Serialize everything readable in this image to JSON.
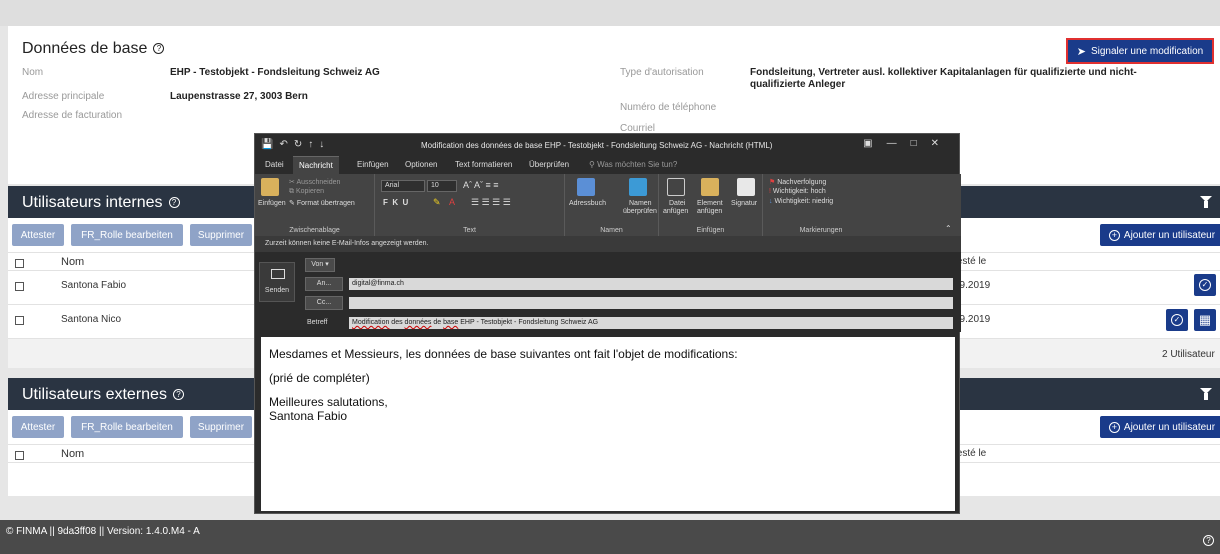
{
  "basic": {
    "title": "Données de base",
    "signal_label": "Signaler une modification",
    "fields": {
      "nom_label": "Nom",
      "nom_value": "EHP - Testobjekt - Fondsleitung Schweiz AG",
      "addr_label": "Adresse principale",
      "addr_value": "Laupenstrasse 27, 3003 Bern",
      "billing_label": "Adresse de facturation",
      "type_label": "Type d'autorisation",
      "type_value": "Fondsleitung, Vertreter ausl. kollektiver Kapitalanlagen für qualifizierte und nicht-qualifizierte Anleger",
      "phone_label": "Numéro de téléphone",
      "email_label": "Courriel"
    }
  },
  "internal": {
    "title": "Utilisateurs internes",
    "buttons": {
      "attester": "Attester",
      "rolle": "FR_Rolle bearbeiten",
      "supprimer": "Supprimer"
    },
    "add_label": "Ajouter un utilisateur",
    "col_name": "Nom",
    "col_tested": "testé le",
    "rows": [
      {
        "name": "Santona Fabio",
        "date": "09.2019"
      },
      {
        "name": "Santona Nico",
        "date": "09.2019"
      }
    ],
    "count": "2 Utilisateur"
  },
  "external": {
    "title": "Utilisateurs externes",
    "buttons": {
      "attester": "Attester",
      "rolle": "FR_Rolle bearbeiten",
      "supprimer": "Supprimer"
    },
    "add_label": "Ajouter un utilisateur",
    "col_name": "Nom",
    "col_tested": "testé le"
  },
  "footer": {
    "text": "© FINMA || 9da3ff08 || Version: 1.4.0.M4 - A"
  },
  "outlook": {
    "window_title": "Modification des données de base EHP - Testobjekt - Fondsleitung Schweiz AG - Nachricht (HTML)",
    "tabs": [
      "Datei",
      "Nachricht",
      "Einfügen",
      "Optionen",
      "Text formatieren",
      "Überprüfen"
    ],
    "tell_me": "Was möchten Sie tun?",
    "ribbon": {
      "paste": "Einfügen",
      "cut": "Ausschneiden",
      "copy": "Kopieren",
      "format_painter": "Format übertragen",
      "clipboard": "Zwischenablage",
      "font_name": "Arial",
      "font_size": "10",
      "text_group": "Text",
      "address_book": "Adressbuch",
      "check_names_1": "Namen",
      "check_names_2": "überprüfen",
      "names_group": "Namen",
      "attach_file_1": "Datei",
      "attach_file_2": "anfügen",
      "attach_item_1": "Element",
      "attach_item_2": "anfügen",
      "signature": "Signatur",
      "insert_group": "Einfügen",
      "follow_up": "Nachverfolgung",
      "high": "Wichtigkeit: hoch",
      "low": "Wichtigkeit: niedrig",
      "tags_group": "Markierungen"
    },
    "info_bar": "Zurzeit können keine E-Mail-Infos angezeigt werden.",
    "from_label": "Von",
    "send_label": "Senden",
    "to_label": "An...",
    "to_value": "digital@finma.ch",
    "cc_label": "Cc...",
    "subject_label": "Betreff",
    "subject_parts": [
      "Modification",
      " des ",
      "données",
      " de ",
      "base",
      " EHP - Testobjekt - Fondsleitung Schweiz AG"
    ],
    "body": {
      "line1": "Mesdames et Messieurs, les données de base suivantes ont fait l'objet de modifications:",
      "line2": "(prié de compléter)",
      "line3": "Meilleures salutations,",
      "line4": "Santona Fabio"
    }
  }
}
